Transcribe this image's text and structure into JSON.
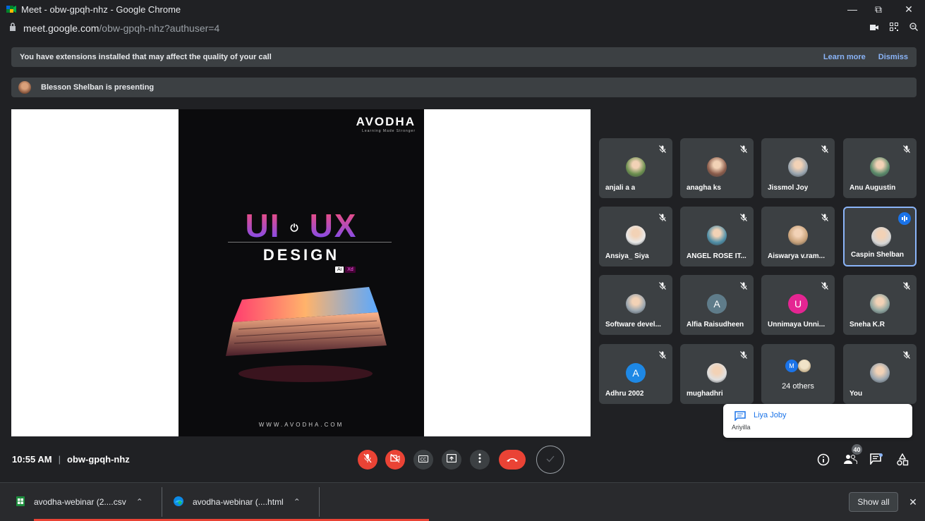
{
  "window": {
    "title": "Meet - obw-gpqh-nhz - Google Chrome",
    "url_host": "meet.google.com",
    "url_path": "/obw-gpqh-nhz?authuser=4"
  },
  "banner_extensions": {
    "text": "You have extensions installed that may affect the quality of your call",
    "learn_more": "Learn more",
    "dismiss": "Dismiss"
  },
  "banner_presenting": {
    "text": "Blesson Shelban is presenting"
  },
  "slide": {
    "brand": "AVODHA",
    "tagline": "Learning Made Stronger",
    "title_left": "UI",
    "title_right": "UX",
    "subtitle": "DESIGN",
    "adobe_label": "Ai",
    "xd_label": "Xd",
    "website": "WWW.AVODHA.COM"
  },
  "participants": [
    {
      "name": "anjali a a",
      "avatar": "photo",
      "color": "#6b8f4e",
      "muted": true
    },
    {
      "name": "anagha ks",
      "avatar": "photo",
      "color": "#8a5b4a",
      "muted": true
    },
    {
      "name": "Jissmol Joy",
      "avatar": "photo",
      "color": "#9aa6b0",
      "muted": true
    },
    {
      "name": "Anu Augustin",
      "avatar": "photo",
      "color": "#5a8a6a",
      "muted": true
    },
    {
      "name": "Ansiya_ Siya",
      "avatar": "photo",
      "color": "#e8e8e8",
      "muted": true
    },
    {
      "name": "ANGEL ROSE IT...",
      "avatar": "photo",
      "color": "#4f8fa8",
      "muted": true
    },
    {
      "name": "Aiswarya v.ram...",
      "avatar": "photo",
      "color": "#c9a27a",
      "muted": true
    },
    {
      "name": "Caspin Shelban",
      "avatar": "photo",
      "color": "#d6d6d6",
      "muted": false,
      "speaking": true
    },
    {
      "name": "Software devel...",
      "avatar": "photo",
      "color": "#9aa6b0",
      "muted": true
    },
    {
      "name": "Alfia Raisudheen",
      "avatar": "letter",
      "letter": "A",
      "color": "#5f7c8a",
      "muted": true
    },
    {
      "name": "Unnimaya Unni...",
      "avatar": "letter",
      "letter": "U",
      "color": "#e52592",
      "muted": true
    },
    {
      "name": "Sneha K.R",
      "avatar": "photo",
      "color": "#8fa6a0",
      "muted": true
    },
    {
      "name": "Adhru 2002",
      "avatar": "letter",
      "letter": "A",
      "color": "#1e88e5",
      "muted": true
    },
    {
      "name": "mughadhri",
      "avatar": "photo",
      "color": "#e0e0e0",
      "muted": true
    },
    {
      "name": "",
      "others": "24 others",
      "mini_letter": "M",
      "muted": false
    },
    {
      "name": "You",
      "avatar": "photo",
      "color": "#9aa6b0",
      "muted": true
    }
  ],
  "chat_toast": {
    "sender": "Liya Joby",
    "message": "Ariyilla"
  },
  "bottom": {
    "time": "10:55 AM",
    "separator": "|",
    "meeting_code": "obw-gpqh-nhz",
    "participant_count": "40"
  },
  "downloads": {
    "items": [
      {
        "label": "avodha-webinar (2....csv"
      },
      {
        "label": "avodha-webinar (....html"
      }
    ],
    "show_all": "Show all"
  },
  "colors": {
    "accent": "#8ab4f8",
    "danger": "#ea4335",
    "surface": "#3c4043",
    "background": "#202124"
  }
}
